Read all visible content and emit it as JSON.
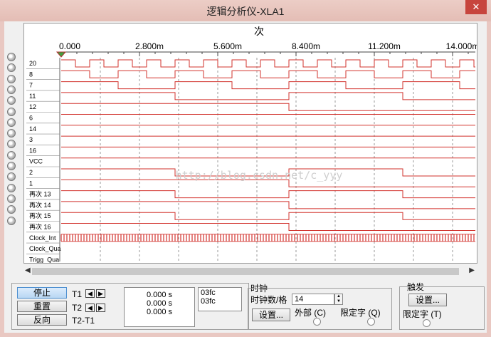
{
  "window": {
    "title": "逻辑分析仪-XLA1",
    "close": "✕"
  },
  "scope": {
    "header": "次",
    "ticks": [
      "0.000",
      "2.800m",
      "5.600m",
      "8.400m",
      "11.200m",
      "14.000m"
    ],
    "watermark": "http://blog.csdn.net/c_yyy",
    "signals": [
      "20",
      "8",
      "7",
      "11",
      "12",
      "6",
      "14",
      "3",
      "16",
      "VCC",
      "2",
      "1",
      "再次 13",
      "再次 14",
      "再次 15",
      "再次 16",
      "Clock_Int",
      "Clock_Qua",
      "Trigg_Qua"
    ],
    "colors": {
      "trace": "#d2332e",
      "grid": "#9a9a9a",
      "text": "#000000"
    }
  },
  "controls": {
    "stop": "停止",
    "reset": "重置",
    "reverse": "反向",
    "t1": "T1",
    "t2": "T2",
    "t2t1": "T2-T1",
    "t1_time": "0.000 s",
    "t2_time": "0.000 s",
    "t2t1_time": "0.000 s",
    "t1_hex": "03fc",
    "t2_hex": "03fc"
  },
  "clock": {
    "group": "时钟",
    "per_div_label": "时钟数/格",
    "per_div_value": "14",
    "setup": "设置...",
    "external": "外部 (C)",
    "qualifier": "限定字 (Q)"
  },
  "trigger": {
    "group": "触发",
    "setup": "设置...",
    "qualifier": "限定字 (T)"
  }
}
